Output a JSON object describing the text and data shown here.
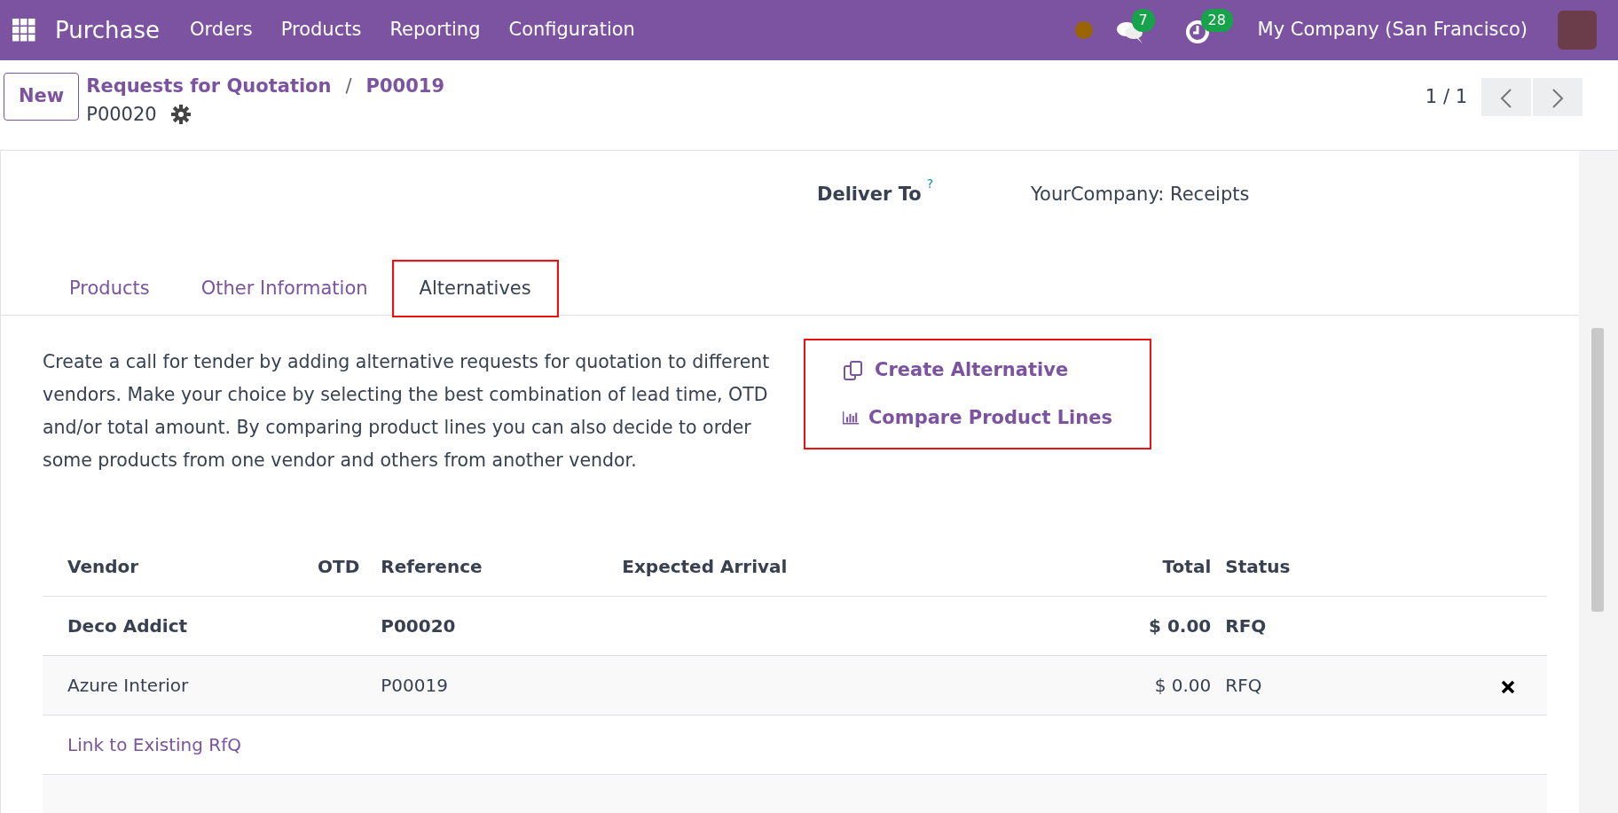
{
  "navbar": {
    "app": "Purchase",
    "menu": [
      "Orders",
      "Products",
      "Reporting",
      "Configuration"
    ],
    "messages_badge": "7",
    "activities_badge": "28",
    "company": "My Company (San Francisco)"
  },
  "control_panel": {
    "new_button": "New",
    "breadcrumbs": [
      "Requests for Quotation",
      "P00019"
    ],
    "separator": "/",
    "record": "P00020",
    "pager": "1 / 1"
  },
  "deliver_to": {
    "label": "Deliver To",
    "help": "?",
    "value": "YourCompany: Receipts"
  },
  "tabs": [
    {
      "label": "Products",
      "selected": false,
      "highlighted": false
    },
    {
      "label": "Other Information",
      "selected": false,
      "highlighted": false
    },
    {
      "label": "Alternatives",
      "selected": true,
      "highlighted": true
    }
  ],
  "description": "Create a call for tender by adding alternative requests for quotation to different vendors. Make your choice by selecting the best combination of lead time, OTD and/or total amount. By comparing product lines you can also decide to order some products from one vendor and others from another vendor.",
  "actions": {
    "highlighted": true,
    "items": [
      {
        "kind": "create",
        "label": "Create Alternative"
      },
      {
        "kind": "compare",
        "label": "Compare Product Lines"
      }
    ]
  },
  "table": {
    "columns": [
      "Vendor",
      "OTD",
      "Reference",
      "Expected Arrival",
      "Total",
      "Status"
    ],
    "rows": [
      {
        "vendor": "Deco Addict",
        "reference": "P00020",
        "total": "$ 0.00",
        "status": "RFQ",
        "current": true,
        "deletable": false
      },
      {
        "vendor": "Azure Interior",
        "reference": "P00019",
        "total": "$ 0.00",
        "status": "RFQ",
        "current": false,
        "deletable": true
      }
    ],
    "link": "Link to Existing RfQ"
  }
}
